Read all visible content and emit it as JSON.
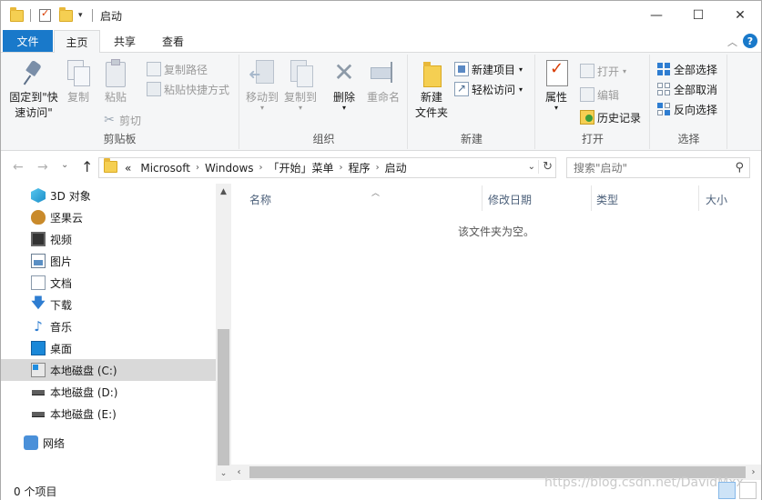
{
  "window": {
    "title": "启动",
    "minimize_glyph": "—",
    "maximize_glyph": "☐",
    "close_glyph": "✕"
  },
  "tabs": {
    "file": "文件",
    "home": "主页",
    "share": "共享",
    "view": "查看",
    "collapse_glyph": "︿",
    "help_glyph": "?"
  },
  "ribbon": {
    "clipboard": {
      "label": "剪贴板",
      "pin_line1": "固定到\"快",
      "pin_line2": "速访问\"",
      "copy": "复制",
      "paste": "粘贴",
      "copy_path": "复制路径",
      "paste_shortcut": "粘贴快捷方式",
      "cut": "剪切"
    },
    "organize": {
      "label": "组织",
      "move_to": "移动到",
      "copy_to": "复制到",
      "delete": "删除",
      "rename": "重命名",
      "delete_glyph": "✕"
    },
    "new": {
      "label": "新建",
      "new_folder_line1": "新建",
      "new_folder_line2": "文件夹",
      "new_item": "新建项目",
      "easy_access": "轻松访问"
    },
    "open": {
      "label": "打开",
      "properties": "属性",
      "open": "打开",
      "edit": "编辑",
      "history": "历史记录"
    },
    "select": {
      "label": "选择",
      "select_all": "全部选择",
      "select_none": "全部取消",
      "invert": "反向选择"
    }
  },
  "address": {
    "back_glyph": "←",
    "forward_glyph": "→",
    "recent_glyph": "⌄",
    "up_glyph": "↑",
    "overflow": "«",
    "crumbs": [
      "Microsoft",
      "Windows",
      "「开始」菜单",
      "程序",
      "启动"
    ],
    "separator": "›",
    "dropdown_glyph": "⌄",
    "refresh_glyph": "↻"
  },
  "search": {
    "placeholder": "搜索\"启动\"",
    "icon_glyph": "⚲"
  },
  "nav": {
    "items": [
      {
        "label": "3D 对象",
        "icon": "3d-objects-icon"
      },
      {
        "label": "坚果云",
        "icon": "nutstore-icon"
      },
      {
        "label": "视频",
        "icon": "videos-icon"
      },
      {
        "label": "图片",
        "icon": "pictures-icon"
      },
      {
        "label": "文档",
        "icon": "documents-icon"
      },
      {
        "label": "下载",
        "icon": "downloads-icon"
      },
      {
        "label": "音乐",
        "icon": "music-icon"
      },
      {
        "label": "桌面",
        "icon": "desktop-icon"
      },
      {
        "label": "本地磁盘 (C:)",
        "icon": "drive-c-icon",
        "selected": true
      },
      {
        "label": "本地磁盘 (D:)",
        "icon": "drive-icon"
      },
      {
        "label": "本地磁盘 (E:)",
        "icon": "drive-icon"
      },
      {
        "label": "网络",
        "icon": "network-icon"
      }
    ],
    "download_glyph": "🡇",
    "music_glyph": "♪",
    "scroll_up_glyph": "▲",
    "scroll_down_glyph": "⌄"
  },
  "content": {
    "columns": [
      "名称",
      "修改日期",
      "类型",
      "大小"
    ],
    "sort_glyph": "︿",
    "empty_message": "该文件夹为空。",
    "scroll_left_glyph": "‹",
    "scroll_right_glyph": "›"
  },
  "status": {
    "item_count": "0 个项目",
    "watermark": "https://blog.csdn.net/DavidMxx"
  },
  "colors": {
    "accent": "#1979ca",
    "folder": "#f5cf52",
    "ribbon_bg": "#f5f6f7",
    "selection": "#d9d9d9"
  }
}
